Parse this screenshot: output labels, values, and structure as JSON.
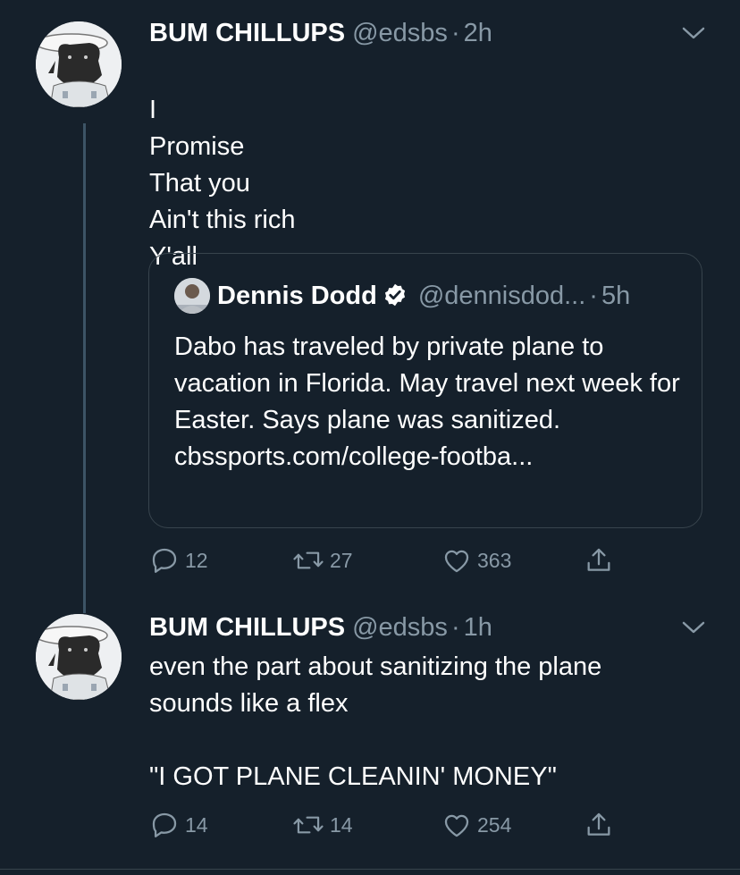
{
  "tweets": [
    {
      "author_name": "BUM CHILLUPS",
      "handle": "@edsbs",
      "time": "2h",
      "text": "I\nPromise\nThat you\nAin't this rich\nY'all",
      "quote": {
        "author_name": "Dennis Dodd",
        "handle": "@dennisdod...",
        "time": "5h",
        "text": "Dabo has traveled by private plane to vacation in Florida. May travel next week for Easter. Says plane was sanitized.  cbssports.com/college-footba..."
      },
      "replies": "12",
      "retweets": "27",
      "likes": "363"
    },
    {
      "author_name": "BUM CHILLUPS",
      "handle": "@edsbs",
      "time": "1h",
      "text": "even the part about sanitizing the plane\nsounds like a flex\n\n\"I GOT PLANE CLEANIN' MONEY\"",
      "replies": "14",
      "retweets": "14",
      "likes": "254"
    }
  ],
  "separator": "·",
  "icons": {
    "caret": "chevron-down-icon",
    "reply": "reply-icon",
    "retweet": "retweet-icon",
    "like": "heart-icon",
    "share": "share-icon",
    "verified": "verified-badge-icon"
  },
  "colors": {
    "background": "#15202b",
    "text": "#ffffff",
    "secondary": "#8899a6",
    "border": "#38444d",
    "verified": "#ffffff"
  }
}
